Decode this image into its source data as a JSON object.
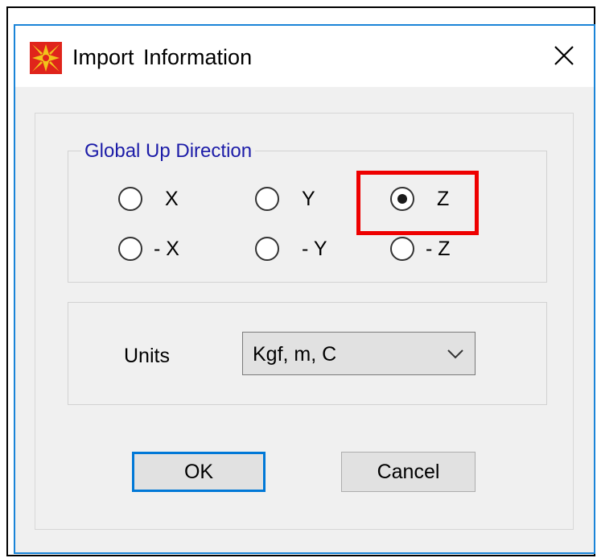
{
  "window": {
    "title": "Import  Information",
    "close_glyph": "✕"
  },
  "global_up_direction": {
    "legend": "Global Up Direction",
    "options": [
      {
        "label": "X",
        "checked": false
      },
      {
        "label": "Y",
        "checked": false
      },
      {
        "label": "Z",
        "checked": true
      },
      {
        "label": "- X",
        "checked": false
      },
      {
        "label": "- Y",
        "checked": false
      },
      {
        "label": "- Z",
        "checked": false
      }
    ]
  },
  "units": {
    "label": "Units",
    "selected": "Kgf, m, C"
  },
  "buttons": {
    "ok_label": "OK",
    "cancel_label": "Cancel"
  },
  "colors": {
    "window_border": "#1a84d8",
    "legend_text": "#1c1ca8",
    "highlight": "#ee0000",
    "default_button_border": "#0078d7",
    "icon_red": "#e0241b",
    "icon_yellow": "#f2c21b"
  },
  "icons": {
    "app": "app-logo-icon",
    "close": "close-icon",
    "dropdown": "chevron-down-icon"
  }
}
